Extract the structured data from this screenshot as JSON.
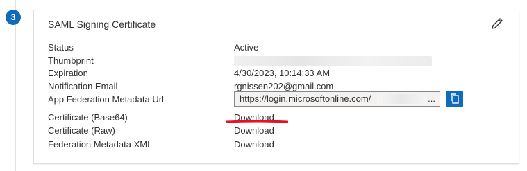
{
  "step": {
    "number": "3"
  },
  "card": {
    "title": "SAML Signing Certificate",
    "edit_icon": "pencil-icon"
  },
  "fields": {
    "status": {
      "label": "Status",
      "value": "Active"
    },
    "thumbprint": {
      "label": "Thumbprint"
    },
    "expiration": {
      "label": "Expiration",
      "value": "4/30/2023, 10:14:33 AM"
    },
    "notification_email": {
      "label": "Notification Email",
      "value": "rgnissen202@gmail.com"
    },
    "metadata_url": {
      "label": "App Federation Metadata Url",
      "value": "https://login.microsoftonline.com/",
      "ellipsis": "...",
      "copy_icon": "copy-icon"
    },
    "cert_base64": {
      "label": "Certificate (Base64)",
      "link": "Download"
    },
    "cert_raw": {
      "label": "Certificate (Raw)",
      "link": "Download"
    },
    "federation_xml": {
      "label": "Federation Metadata XML",
      "link": "Download"
    }
  },
  "colors": {
    "accent": "#0f6cbd",
    "annotation": "#e81123"
  }
}
